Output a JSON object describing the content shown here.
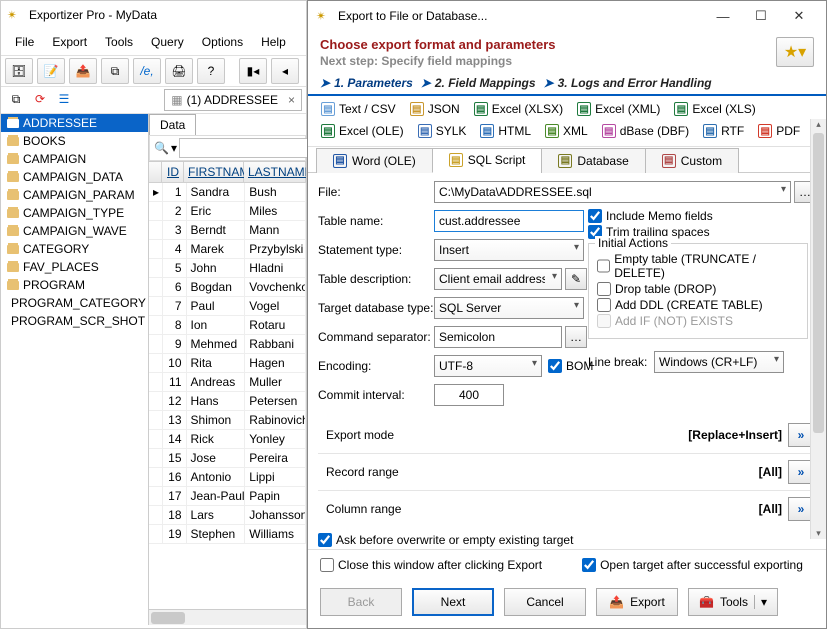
{
  "mainWindow": {
    "title": "Exportizer Pro - MyData",
    "menu": [
      "File",
      "Export",
      "Tools",
      "Query",
      "Options",
      "Help"
    ],
    "tabLabel": "(1) ADDRESSEE",
    "dataTab": "Data"
  },
  "tree": {
    "items": [
      "ADDRESSEE",
      "BOOKS",
      "CAMPAIGN",
      "CAMPAIGN_DATA",
      "CAMPAIGN_PARAM",
      "CAMPAIGN_TYPE",
      "CAMPAIGN_WAVE",
      "CATEGORY",
      "FAV_PLACES",
      "PROGRAM",
      "PROGRAM_CATEGORY",
      "PROGRAM_SCR_SHOT"
    ],
    "selected": 0
  },
  "grid": {
    "cols": [
      "ID",
      "FIRSTNAME",
      "LASTNAME"
    ],
    "rows": [
      {
        "id": 1,
        "fn": "Sandra",
        "ln": "Bush"
      },
      {
        "id": 2,
        "fn": "Eric",
        "ln": "Miles"
      },
      {
        "id": 3,
        "fn": "Berndt",
        "ln": "Mann"
      },
      {
        "id": 4,
        "fn": "Marek",
        "ln": "Przybylski"
      },
      {
        "id": 5,
        "fn": "John",
        "ln": "Hladni"
      },
      {
        "id": 6,
        "fn": "Bogdan",
        "ln": "Vovchenko"
      },
      {
        "id": 7,
        "fn": "Paul",
        "ln": "Vogel"
      },
      {
        "id": 8,
        "fn": "Ion",
        "ln": "Rotaru"
      },
      {
        "id": 9,
        "fn": "Mehmed",
        "ln": "Rabbani"
      },
      {
        "id": 10,
        "fn": "Rita",
        "ln": "Hagen"
      },
      {
        "id": 11,
        "fn": "Andreas",
        "ln": "Muller"
      },
      {
        "id": 12,
        "fn": "Hans",
        "ln": "Petersen"
      },
      {
        "id": 13,
        "fn": "Shimon",
        "ln": "Rabinovich"
      },
      {
        "id": 14,
        "fn": "Rick",
        "ln": "Yonley"
      },
      {
        "id": 15,
        "fn": "Jose",
        "ln": "Pereira"
      },
      {
        "id": 16,
        "fn": "Antonio",
        "ln": "Lippi"
      },
      {
        "id": 17,
        "fn": "Jean-Paul",
        "ln": "Papin"
      },
      {
        "id": 18,
        "fn": "Lars",
        "ln": "Johansson"
      },
      {
        "id": 19,
        "fn": "Stephen",
        "ln": "Williams"
      }
    ]
  },
  "dialog": {
    "title": "Export to File or Database...",
    "heading": "Choose export format and parameters",
    "subheading": "Next step: Specify field mappings",
    "steps": [
      "1. Parameters",
      "2. Field Mappings",
      "3. Logs and Error Handling"
    ],
    "formats": [
      "Text / CSV",
      "JSON",
      "Excel (XLSX)",
      "Excel (XML)",
      "Excel (XLS)",
      "Excel (OLE)",
      "SYLK",
      "HTML",
      "XML",
      "dBase (DBF)",
      "RTF",
      "PDF"
    ],
    "tabs": [
      "Word (OLE)",
      "SQL Script",
      "Database",
      "Custom"
    ],
    "activeTab": 1,
    "fields": {
      "fileLabel": "File:",
      "file": "C:\\MyData\\ADDRESSEE.sql",
      "tableNameLabel": "Table name:",
      "tableName": "cust.addressee",
      "stmtTypeLabel": "Statement type:",
      "stmtType": "Insert",
      "tableDescLabel": "Table description:",
      "tableDesc": "Client email addresses",
      "targetDbLabel": "Target database type:",
      "targetDb": "SQL Server",
      "cmdSepLabel": "Command separator:",
      "cmdSep": "Semicolon",
      "encodingLabel": "Encoding:",
      "encoding": "UTF-8",
      "bomLabel": "BOM",
      "commitLabel": "Commit interval:",
      "commit": "400",
      "lineBreakLabel": "Line break:",
      "lineBreak": "Windows (CR+LF)"
    },
    "checks": {
      "memo": "Include Memo fields",
      "trim": "Trim trailing spaces",
      "initial": "Initial Actions",
      "empty": "Empty table (TRUNCATE / DELETE)",
      "drop": "Drop table (DROP)",
      "ddl": "Add DDL (CREATE TABLE)",
      "ifnot": "Add IF (NOT) EXISTS"
    },
    "modes": {
      "exportMode": {
        "label": "Export mode",
        "value": "[Replace+Insert]"
      },
      "recordRange": {
        "label": "Record range",
        "value": "[All]"
      },
      "columnRange": {
        "label": "Column range",
        "value": "[All]"
      }
    },
    "askOverwrite": "Ask before overwrite or empty existing target",
    "footer": {
      "close": "Close this window after clicking Export",
      "open": "Open target after successful exporting",
      "back": "Back",
      "next": "Next",
      "cancel": "Cancel",
      "export": "Export",
      "tools": "Tools"
    }
  },
  "iconColors": {
    "txt": "#6aa0d8",
    "json": "#c9972e",
    "xlsx": "#1f7a3e",
    "xlsm": "#1f7a3e",
    "xls": "#1f7a3e",
    "ole": "#1f7a3e",
    "sylk": "#3a6db5",
    "html": "#2d6fb8",
    "xml": "#4a8a2a",
    "dbf": "#b64aa2",
    "rtf": "#2e6fb0",
    "pdf": "#d23a2a",
    "word": "#2458a6",
    "sql": "#caa22a",
    "db": "#7a7a22",
    "custom": "#b04848"
  }
}
